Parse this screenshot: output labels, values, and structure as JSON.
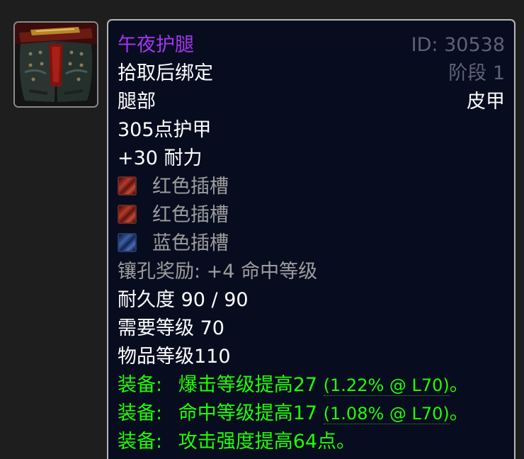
{
  "icon": {
    "name": "leather-legs-armor-icon"
  },
  "tooltip": {
    "item_name": "午夜护腿",
    "item_id": "ID: 30538",
    "binding": "拾取后绑定",
    "phase": "阶段 1",
    "slot": "腿部",
    "armor_type": "皮甲",
    "armor": "305点护甲",
    "stamina": "+30 耐力",
    "sockets": [
      {
        "color": "red",
        "label": "红色插槽"
      },
      {
        "color": "red",
        "label": "红色插槽"
      },
      {
        "color": "blue",
        "label": "蓝色插槽"
      }
    ],
    "socket_bonus": "镶孔奖励: +4 命中等级",
    "durability": "耐久度 90 / 90",
    "required_level": "需要等级 70",
    "item_level": "物品等级110",
    "equip_effects": [
      {
        "prefix": "装备:",
        "text": "爆击等级提高27",
        "extra": "(1.22% @ L70)",
        "end": "。"
      },
      {
        "prefix": "装备:",
        "text": "命中等级提高17",
        "extra": "(1.08% @ L70)",
        "end": "。"
      },
      {
        "prefix": "装备:",
        "text": "攻击强度提高64点。",
        "extra": "",
        "end": ""
      }
    ]
  },
  "colors": {
    "epic": "#a335ee",
    "muted": "#5c6379",
    "gray": "#9d9d9d",
    "equip_green": "#1eff00",
    "tooltip_bg": "#070c1f",
    "page_bg": "#1e1e1e"
  }
}
